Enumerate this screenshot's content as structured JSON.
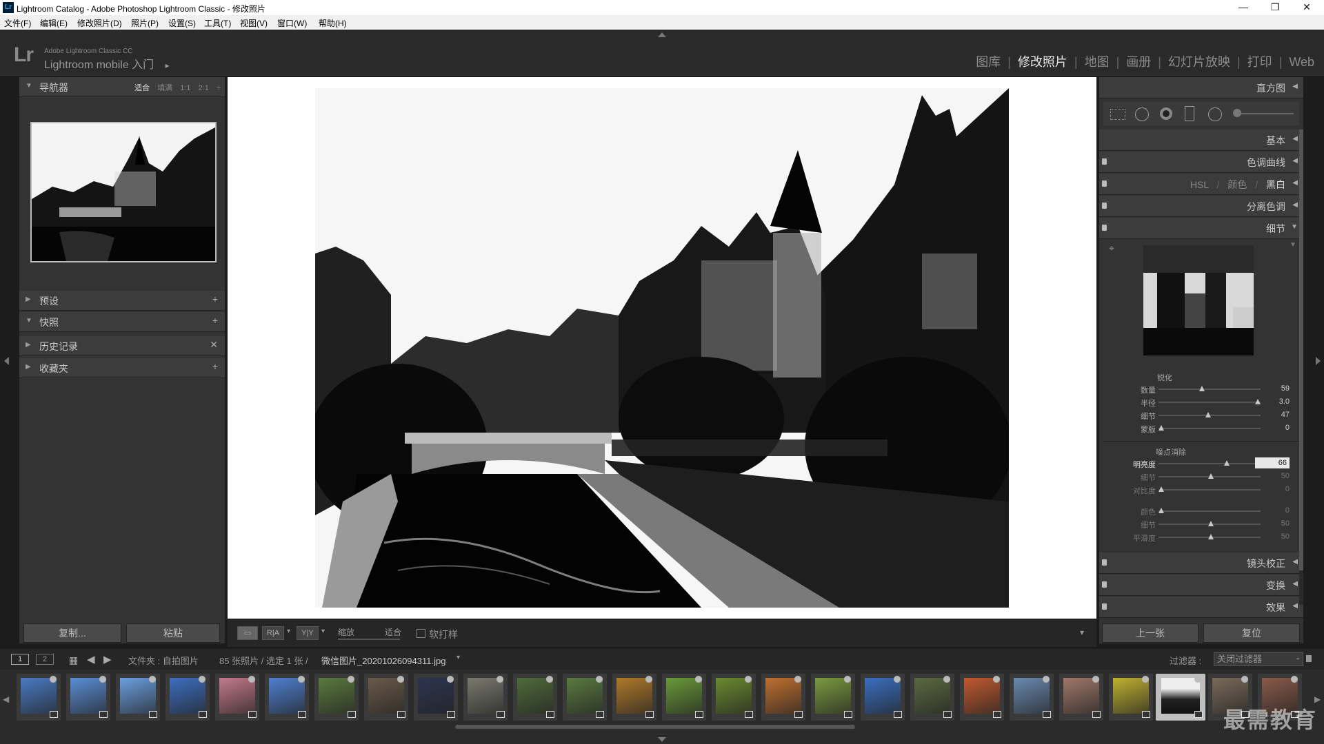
{
  "titlebar": {
    "icon": "Lr",
    "title": "Lightroom Catalog - Adobe Photoshop Lightroom Classic - 修改照片",
    "minimize": "—",
    "maximize": "❐",
    "close": "✕"
  },
  "menu": [
    "文件(F)",
    "编辑(E)",
    "修改照片(D)",
    "照片(P)",
    "设置(S)",
    "工具(T)",
    "视图(V)",
    "窗口(W)",
    "帮助(H)"
  ],
  "identity": {
    "logo": "Lr",
    "product": "Adobe Lightroom Classic CC",
    "mobile": "Lightroom mobile 入门",
    "mobile_arrow": "▸"
  },
  "modules": [
    {
      "label": "图库",
      "active": false
    },
    {
      "label": "修改照片",
      "active": true
    },
    {
      "label": "地图",
      "active": false
    },
    {
      "label": "画册",
      "active": false
    },
    {
      "label": "幻灯片放映",
      "active": false
    },
    {
      "label": "打印",
      "active": false
    },
    {
      "label": "Web",
      "active": false
    }
  ],
  "left": {
    "navigator": {
      "label": "导航器",
      "opts": [
        "适合",
        "填满",
        "1:1",
        "2:1"
      ],
      "dropdown": "÷"
    },
    "panels": [
      {
        "label": "预设",
        "action": "+",
        "open": false
      },
      {
        "label": "快照",
        "action": "+",
        "open": true
      },
      {
        "label": "历史记录",
        "action": "✕",
        "open": false
      },
      {
        "label": "收藏夹",
        "action": "+",
        "open": false
      }
    ],
    "copy_button": "复制...",
    "paste_button": "粘贴"
  },
  "toolbar": {
    "loupe": "▭",
    "compare": "R|A",
    "survey": "Y|Y",
    "zoom_label": "缩放",
    "zoom_value": "适合",
    "softproof": "软打样",
    "softproof_checked": false,
    "menu_arrow": "▾"
  },
  "right": {
    "histogram": "直方图",
    "basic": "基本",
    "tone_curve": "色调曲线",
    "hsl": "HSL",
    "color": "颜色",
    "bw": "黑白",
    "split": "分离色调",
    "detail": "细节",
    "sharpen": {
      "label": "锐化",
      "rows": [
        {
          "name": "数量",
          "value": "59",
          "pos": 0.41
        },
        {
          "name": "半径",
          "value": "3.0",
          "pos": 0.97
        },
        {
          "name": "细节",
          "value": "47",
          "pos": 0.47
        },
        {
          "name": "蒙版",
          "value": "0",
          "pos": 0.0
        }
      ]
    },
    "noise": {
      "label": "噪点消除",
      "rows": [
        {
          "name": "明亮度",
          "value": "66",
          "pos": 0.66,
          "dim": false
        },
        {
          "name": "细节",
          "value": "50",
          "pos": 0.5,
          "dim": true
        },
        {
          "name": "对比度",
          "value": "0",
          "pos": 0.0,
          "dim": true
        }
      ],
      "color_rows": [
        {
          "name": "颜色",
          "value": "0",
          "pos": 0.0,
          "dim": true
        },
        {
          "name": "细节",
          "value": "50",
          "pos": 0.5,
          "dim": true
        },
        {
          "name": "平滑度",
          "value": "50",
          "pos": 0.5,
          "dim": true
        }
      ]
    },
    "lens": "镜头校正",
    "transform": "变换",
    "effects": "效果",
    "prev_button": "上一张",
    "reset_button": "复位"
  },
  "filmbar": {
    "view1": "1",
    "view2": "2",
    "source": "文件夹 : 自拍图片",
    "count": "85 张照片 / 选定 1 张 /",
    "filename": "微信图片_20201026094311.jpg",
    "filename_arrow": "▾",
    "filter_label": "过滤器 :",
    "filter_value": "关闭过滤器"
  },
  "thumb_colors": [
    "#4a7bc4",
    "#5a8fd6",
    "#6b9fe0",
    "#3d6fc0",
    "#c47a8a",
    "#4f80d0",
    "#5a7a3e",
    "#6a5a4a",
    "#2c3550",
    "#7a7a70",
    "#4f6b3a",
    "#5a7a40",
    "#b07a2a",
    "#6a9a3a",
    "#6a8a30",
    "#c07030",
    "#7a9a40",
    "#3a70c0",
    "#5a6a40",
    "#c05a30",
    "#6a8ab0",
    "#a0786a",
    "#c0b030",
    "#555555",
    "#7a6a5a",
    "#8a5a4a"
  ],
  "watermark": "最需教育"
}
